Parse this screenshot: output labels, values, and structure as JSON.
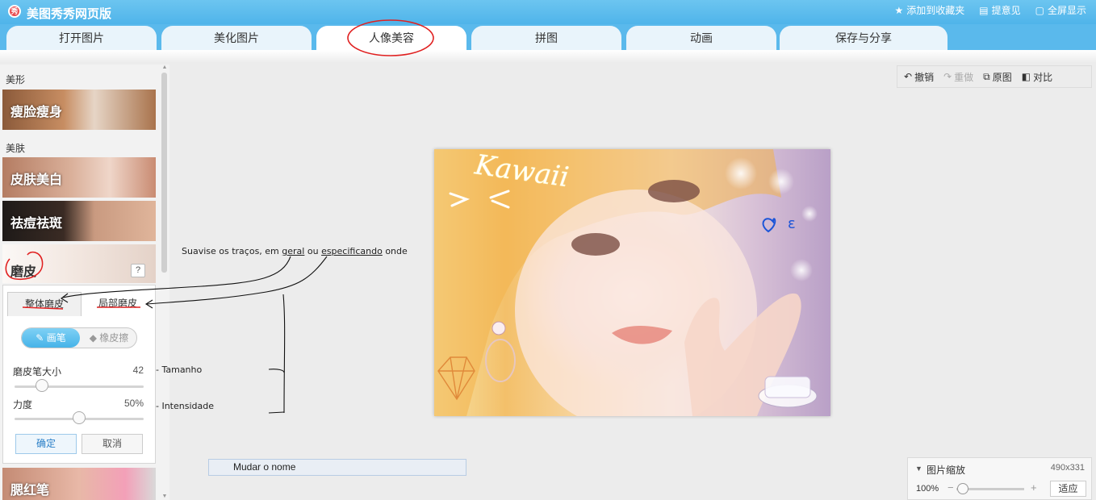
{
  "app": {
    "title": "美图秀秀网页版",
    "logo_text": "秀"
  },
  "top_links": {
    "favorite": "添加到收藏夹",
    "feedback": "提意见",
    "fullscreen": "全屏显示"
  },
  "tabs": [
    "打开图片",
    "美化图片",
    "人像美容",
    "拼图",
    "动画",
    "保存与分享"
  ],
  "active_tab": "人像美容",
  "sidebar": {
    "section_shape": "美形",
    "item_slim": "瘦脸瘦身",
    "section_skin": "美肤",
    "item_whiten": "皮肤美白",
    "item_acne": "祛痘祛斑",
    "item_smooth": "磨皮",
    "help": "?",
    "item_blush": "腮红笔"
  },
  "smooth_panel": {
    "tab_global": "整体磨皮",
    "tab_local": "局部磨皮",
    "tool_brush": "画笔",
    "tool_eraser": "橡皮擦",
    "brush_size_label": "磨皮笔大小",
    "brush_size_value": "42",
    "brush_size_level": 0.21,
    "strength_label": "力度",
    "strength_value": "50%",
    "strength_level": 0.5,
    "ok": "确定",
    "cancel": "取消"
  },
  "annotations": {
    "note_main_prefix": "Suavise os traços, em ",
    "note_main_geral": "geral",
    "note_main_mid": " ou ",
    "note_main_esp": "especificando",
    "note_main_suffix": " onde",
    "note_size": "- Tamanho",
    "note_intensity": "- Intensidade"
  },
  "edit_toolbar": {
    "undo": "撤销",
    "redo": "重做",
    "original": "原图",
    "compare": "对比"
  },
  "photo": {
    "overlay_text": "Kawaii"
  },
  "rename_bar": "Mudar o nome",
  "zoom": {
    "title": "图片缩放",
    "size": "490x331",
    "percent": "100%",
    "fit": "适应",
    "level": 0.1
  },
  "colors": {
    "accent": "#5ab9ec",
    "annotation_red": "#e02020"
  }
}
